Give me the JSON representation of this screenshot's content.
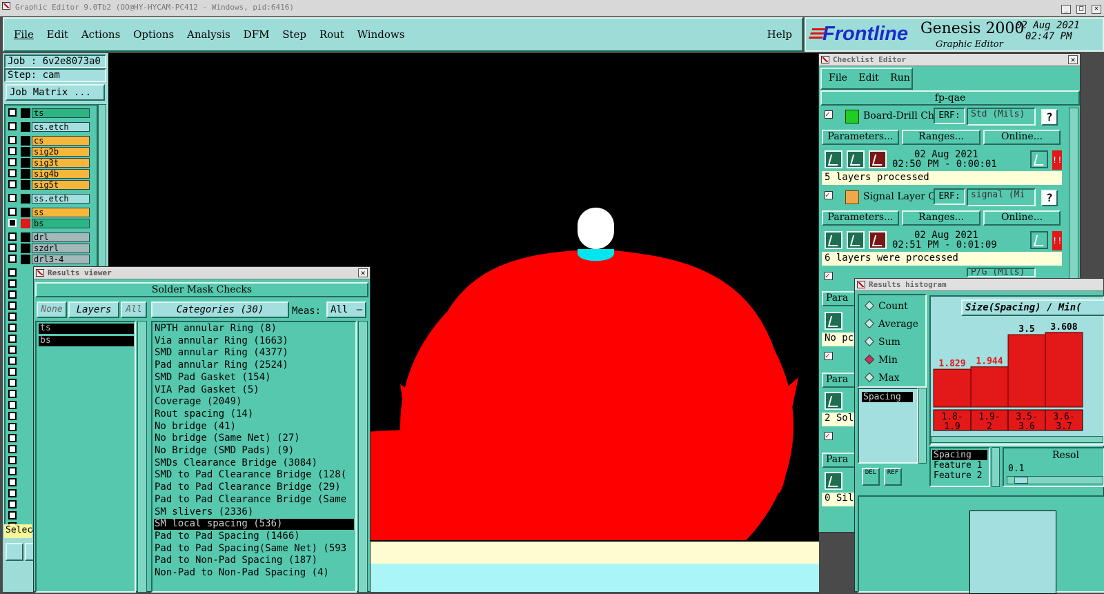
{
  "window": {
    "title": "Graphic Editor 9.0Tb2 (OO@HY-HYCAM-PC412 - Windows, pid:6416)"
  },
  "menubar": {
    "items": [
      "File",
      "Edit",
      "Actions",
      "Options",
      "Analysis",
      "DFM",
      "Step",
      "Rout",
      "Windows"
    ],
    "help": "Help"
  },
  "brand": {
    "logo": "Frontline",
    "product": "Genesis 2000",
    "subtitle": "Graphic Editor",
    "date": "02 Aug 2021",
    "time": "02:47 PM"
  },
  "job": {
    "job": "Job : 6v2e8073a0",
    "step": "Step: cam",
    "matrix": "Job Matrix ..."
  },
  "layers": [
    {
      "name": "ts",
      "color": "#2bb582"
    },
    {
      "name": "cs.etch",
      "color": "#a3dfdf"
    },
    {
      "name": "cs",
      "color": "#f5b63a"
    },
    {
      "name": "sig2b",
      "color": "#f5b63a"
    },
    {
      "name": "sig3t",
      "color": "#f5b63a"
    },
    {
      "name": "sig4b",
      "color": "#f5b63a"
    },
    {
      "name": "sig5t",
      "color": "#f5b63a"
    },
    {
      "name": "ss.etch",
      "color": "#a3dfdf"
    },
    {
      "name": "ss",
      "color": "#f5b63a"
    },
    {
      "name": "bs",
      "color": "#2bb582"
    },
    {
      "name": "drl",
      "color": "#a3b8b8"
    },
    {
      "name": "szdrl",
      "color": "#a3b8b8"
    },
    {
      "name": "drl3-4",
      "color": "#a3b8b8"
    }
  ],
  "select_label": "Selec",
  "results_viewer": {
    "title": "Results viewer",
    "heading": "Solder Mask Checks",
    "none": "None",
    "layers": "Layers",
    "all": "All",
    "categories": "Categories (30)",
    "meas": "Meas:",
    "meas_value": "All",
    "layer_items": [
      "ts",
      "bs"
    ],
    "category_items": [
      "NPTH annular Ring (8)",
      "Via annular Ring (1663)",
      "SMD annular Ring (4377)",
      "Pad annular Ring (2524)",
      "SMD Pad Gasket (154)",
      "VIA Pad Gasket (5)",
      "Coverage (2049)",
      "Rout spacing (14)",
      "No bridge (41)",
      "No bridge (Same Net) (27)",
      "No Bridge (SMD Pads) (9)",
      "SMDs Clearance Bridge (3084)",
      "SMD to Pad Clearance Bridge (128(",
      "Pad to Pad Clearance Bridge (29)",
      "Pad to Pad Clearance Bridge (Same",
      "SM slivers (2336)",
      "SM local spacing (536)",
      "Pad to Pad Spacing (1466)",
      "Pad to Pad Spacing(Same Net) (593",
      "Pad to Non-Pad Spacing (187)",
      "Non-Pad to Non-Pad Spacing (4)"
    ],
    "selected_index": 16
  },
  "checklist": {
    "title": "Checklist Editor",
    "menu": [
      "File",
      "Edit",
      "Run"
    ],
    "name": "fp-qae",
    "checks": [
      {
        "name": "Board-Drill Che",
        "erf": "ERF:",
        "erf_value": "Std (Mils)",
        "date": "02 Aug 2021",
        "time": "02:50 PM - 0:00:01",
        "status": "5 layers processed"
      },
      {
        "name": "Signal Layer Ch",
        "erf": "ERF:",
        "erf_value": "signal (Mi",
        "date": "02 Aug 2021",
        "time": "02:51 PM - 0:01:09",
        "status": "6 layers were processed"
      }
    ],
    "params": "Parameters...",
    "ranges": "Ranges...",
    "online": "Online...",
    "partial": [
      "Para",
      "No pc",
      "Para",
      "2 Sol",
      "Para",
      "0 Sil"
    ],
    "third_erf": "P/G (Mils)"
  },
  "histogram": {
    "title": "Results histogram",
    "modes": [
      "Count",
      "Average",
      "Sum",
      "Min",
      "Max"
    ],
    "selected_mode": "Min",
    "list_item": "Spacing",
    "axis_title": "Size(Spacing) / Min(",
    "del": "DEL",
    "ref": "REF",
    "attrs": [
      "Spacing",
      "Feature 1",
      "Feature 2"
    ],
    "resol_label": "Resol",
    "resol_value": "0.1"
  },
  "chart_data": {
    "type": "bar",
    "categories": [
      "1.8-\n1.9",
      "1.9-\n2",
      "3.5-\n3.6",
      "3.6-\n3.7"
    ],
    "values": [
      1.829,
      1.944,
      3.5,
      3.608
    ],
    "labels": [
      "1.829",
      "1.944",
      "3.5",
      "3.608"
    ],
    "title": "Size(Spacing) / Min("
  },
  "colors": {
    "teal": "#56c8ad",
    "light": "#a3dfdf",
    "red": "#ff0000",
    "cyan": "#00e5ee",
    "canvas": "#000000"
  }
}
